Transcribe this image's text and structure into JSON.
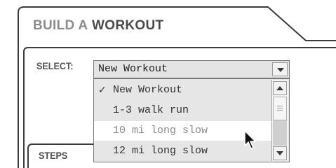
{
  "panel": {
    "title_light": "BUILD A",
    "title_strong": "WORKOUT"
  },
  "select": {
    "label": "SELECT:",
    "value": "New Workout"
  },
  "dropdown": {
    "options": [
      {
        "label": "New Workout",
        "checked": true
      },
      {
        "label": "1-3 walk run",
        "checked": false
      },
      {
        "label": "10 mi long slow",
        "checked": false,
        "hovered": true
      },
      {
        "label": "12 mi long slow",
        "checked": false
      }
    ],
    "check_glyph": "✓"
  },
  "steps": {
    "label": "STEPS"
  },
  "icons": [
    "chevron-down-icon",
    "scroll-up-icon",
    "scroll-down-icon",
    "check-icon",
    "mouse-pointer-icon"
  ]
}
